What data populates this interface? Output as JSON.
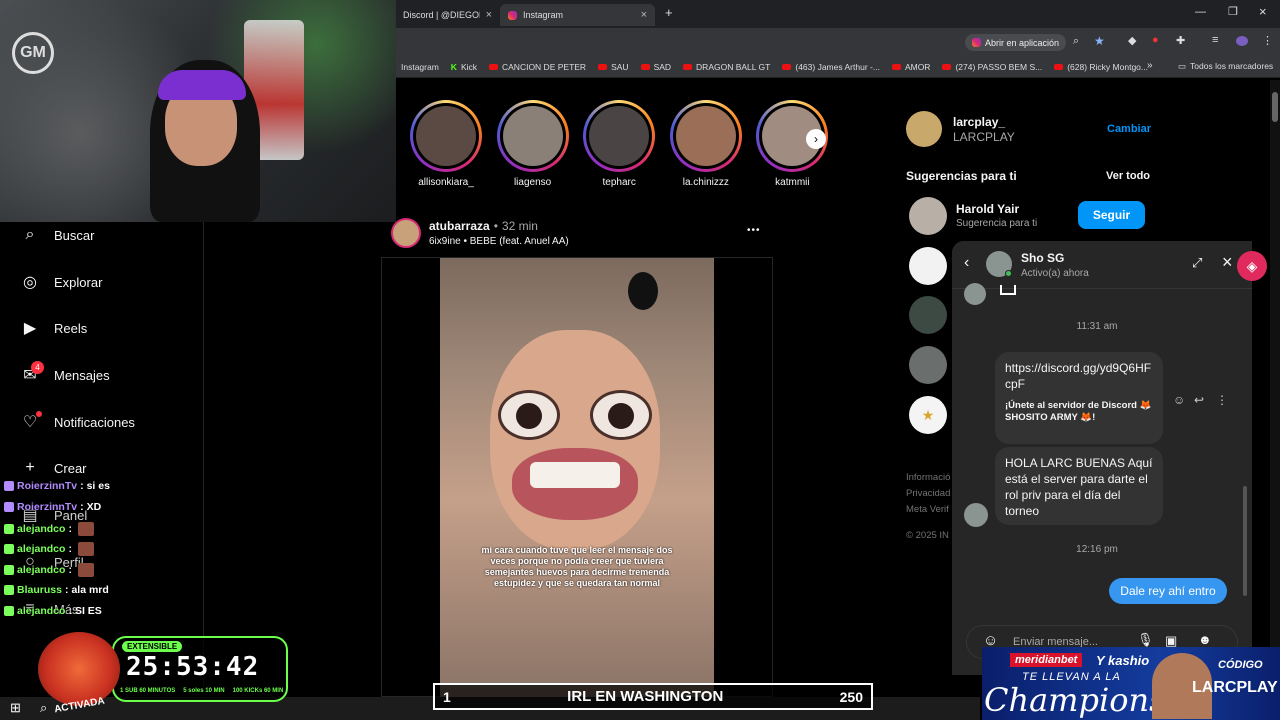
{
  "browser": {
    "tabs": [
      {
        "label": "Discord | @DIEGOMAL"
      },
      {
        "label": "Instagram"
      }
    ],
    "open_app_label": "Abrir en aplicación",
    "bookmarks": [
      {
        "label": "Instagram",
        "icon": "none"
      },
      {
        "label": "Kick",
        "icon": "kick"
      },
      {
        "label": "CANCION DE PETER",
        "icon": "youtube"
      },
      {
        "label": "SAU",
        "icon": "youtube"
      },
      {
        "label": "SAD",
        "icon": "youtube"
      },
      {
        "label": "DRAGON BALL GT",
        "icon": "youtube"
      },
      {
        "label": "(463) James Arthur -...",
        "icon": "youtube"
      },
      {
        "label": "AMOR",
        "icon": "youtube"
      },
      {
        "label": "(274) PASSO BEM S...",
        "icon": "youtube"
      },
      {
        "label": "(628) Ricky Montgo...",
        "icon": "youtube"
      }
    ],
    "more_bookmarks": "»",
    "all_bookmarks": "Todos los marcadores"
  },
  "nav": {
    "items": [
      {
        "label": "Buscar",
        "icon": "search-icon",
        "glyph": "⌕"
      },
      {
        "label": "Explorar",
        "icon": "compass-icon",
        "glyph": "◎"
      },
      {
        "label": "Reels",
        "icon": "reels-icon",
        "glyph": "▶"
      },
      {
        "label": "Mensajes",
        "icon": "messenger-icon",
        "glyph": "✉"
      },
      {
        "label": "Notificaciones",
        "icon": "heart-icon",
        "glyph": "♡"
      },
      {
        "label": "Crear",
        "icon": "plus-icon",
        "glyph": "+"
      },
      {
        "label": "Panel",
        "icon": "dashboard-icon",
        "glyph": "▤"
      },
      {
        "label": "Perfil",
        "icon": "profile-icon",
        "glyph": "○"
      },
      {
        "label": "Más",
        "icon": "menu-icon",
        "glyph": "≡"
      }
    ],
    "messages_badge": "4"
  },
  "stream_chat": [
    {
      "user": "RoierzinnTv",
      "msg": "si es",
      "color": "#b28cff"
    },
    {
      "user": "RoierzinnTv",
      "msg": "XD",
      "color": "#b28cff"
    },
    {
      "user": "alejandco",
      "msg": "",
      "color": "#7cff5c",
      "emote": true
    },
    {
      "user": "alejandco",
      "msg": "",
      "color": "#7cff5c",
      "emote": true
    },
    {
      "user": "alejandco",
      "msg": "",
      "color": "#7cff5c",
      "emote": true
    },
    {
      "user": "Blauruss",
      "msg": "ala mrd",
      "color": "#7cff5c"
    },
    {
      "user": "alejandco",
      "msg": "SI ES",
      "color": "#7cff5c"
    }
  ],
  "stories": [
    {
      "name": "allisonkiara_",
      "color": "#5b4a44"
    },
    {
      "name": "liagenso",
      "color": "#8a8078"
    },
    {
      "name": "tepharc",
      "color": "#4a4444"
    },
    {
      "name": "la.chinizzz",
      "color": "#9b6e58"
    },
    {
      "name": "katmmii",
      "color": "#a08c80"
    }
  ],
  "post": {
    "username": "atubarraza",
    "time": "32 min",
    "song": "6ix9ine • BEBE (feat. Anuel AA)",
    "more": "•••",
    "caption": "mi cara cuando tuve que leer el mensaje dos veces porque no podía creer que tuviera semejantes huevos para decirme tremenda estupidez y que se quedara tan normal"
  },
  "sidebar": {
    "account": {
      "username": "larcplay_",
      "name": "LARCPLAY",
      "switch": "Cambiar"
    },
    "suggestions_title": "Sugerencias para ti",
    "see_all": "Ver todo",
    "suggestion": {
      "name": "Harold Yair",
      "sub": "Sugerencia para ti",
      "follow": "Seguir"
    },
    "footer": [
      "Informació",
      "Privacidad",
      "Meta Verif",
      "© 2025 IN"
    ]
  },
  "chat_popup": {
    "name": "Sho SG",
    "status": "Activo(a) ahora",
    "time1": "11:31 am",
    "link": "https://discord.gg/yd9Q6HFcpF",
    "invite": "¡Únete al servidor de Discord 🦊 SHOSITO ARMY 🦊!",
    "message": "HOLA LARC BUENAS Aquí está el server para darte el rol priv para el día del torneo",
    "time2": "12:16 pm",
    "reply": "Dale rey ahí entro",
    "input_placeholder": "Enviar mensaje..."
  },
  "overlay": {
    "irl_left": "1",
    "irl_title": "IRL EN WASHINGTON",
    "irl_right": "250",
    "timer_badge": "EXTENSIBLE",
    "timer": "25:53:42",
    "sub_info": [
      "1 SUB 60 MINUTOS",
      "5 soles 10 MIN",
      "100 KICKs 60 MIN"
    ],
    "mascot_label": "ACTIVADA"
  },
  "ad": {
    "brand": "meridianbet",
    "partner": "Y kashio",
    "tagline": "TE LLEVAN A LA",
    "headline": "Champions",
    "code_label": "CÓDIGO",
    "code": "LARCPLAY"
  }
}
